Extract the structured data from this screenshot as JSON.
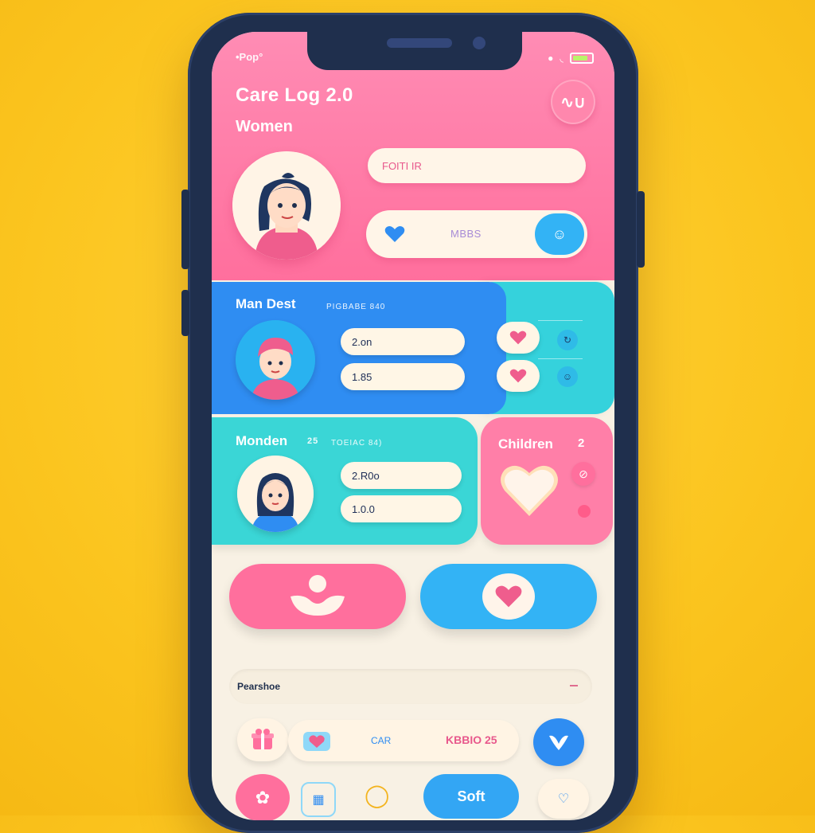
{
  "status_bar": {
    "left_text": "•Pop°",
    "right_icons": [
      "signal-icon",
      "wifi-icon",
      "battery-icon"
    ]
  },
  "header": {
    "title": "Care Log 2.0",
    "subtitle": "Women",
    "input_text": "FOITI IR",
    "mood_label": "MBBS"
  },
  "cards": {
    "man": {
      "title": "Man Dest",
      "sub": "PIGBABE 840",
      "value1": "2.on",
      "value2": "1.85"
    },
    "women": {
      "title": "Monden",
      "count": "25",
      "sub": "TOEIAC 84)",
      "value1": "2.R0o",
      "value2": "1.0.0"
    },
    "children": {
      "title": "Children",
      "count": "2"
    }
  },
  "search": {
    "label": "Pearshoe"
  },
  "bottom_row": {
    "car_label": "CAR",
    "kb_label": "KBBIO 25",
    "soft_label": "Soft"
  },
  "colors": {
    "pink": "#ff6f9d",
    "blue": "#2f8df2",
    "teal": "#3ad6d6",
    "cream": "#f8f1e4",
    "background": "#fbc51f",
    "frame": "#1f2f4d"
  }
}
